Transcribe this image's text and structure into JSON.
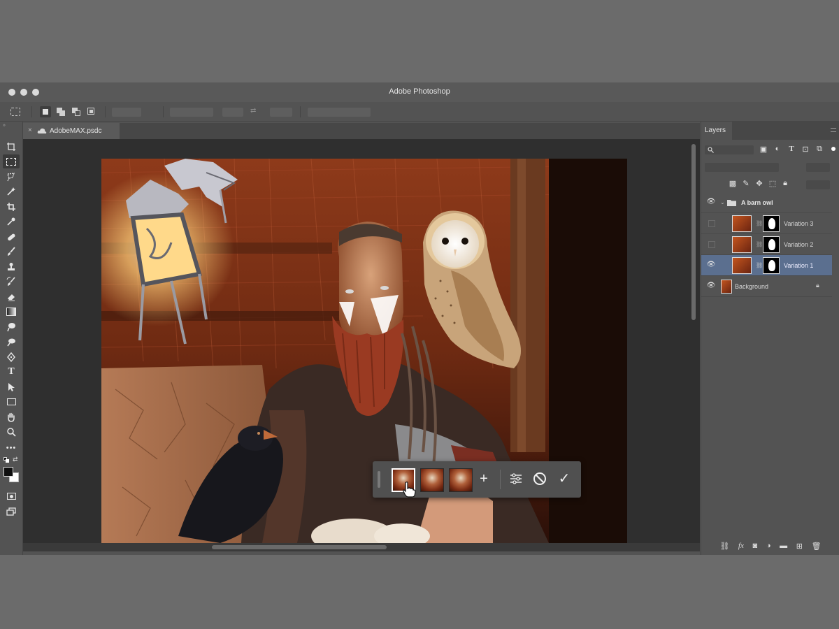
{
  "app": {
    "title": "Adobe Photoshop"
  },
  "document": {
    "tab_name": "AdobeMAX.psdc",
    "close_symbol": "×"
  },
  "toolbar": {
    "tools": [
      "move-tool",
      "marquee-tool",
      "lasso-tool",
      "magic-wand-tool",
      "crop-tool",
      "eyedropper-tool",
      "healing-tool",
      "brush-tool",
      "clone-stamp-tool",
      "history-brush-tool",
      "eraser-tool",
      "gradient-tool",
      "smudge-tool",
      "dodge-tool",
      "pen-tool",
      "type-tool",
      "path-selection-tool",
      "rectangle-tool",
      "hand-tool",
      "zoom-tool",
      "more-tools"
    ],
    "type_glyph": "T"
  },
  "layers_panel": {
    "tab_label": "Layers",
    "layers": [
      {
        "name": "A barn owl",
        "kind": "group",
        "visible": true
      },
      {
        "name": "Variation 3",
        "kind": "layer",
        "visible": false
      },
      {
        "name": "Variation 2",
        "kind": "layer",
        "visible": false
      },
      {
        "name": "Variation 1",
        "kind": "layer",
        "visible": true,
        "selected": true
      },
      {
        "name": "Background",
        "kind": "background",
        "visible": true,
        "locked": true
      }
    ]
  },
  "variations_bar": {
    "thumbnails": 3,
    "selected_index": 0,
    "add_symbol": "+",
    "confirm_symbol": "✓"
  },
  "colors": {
    "app_bg": "#535353",
    "canvas_bg": "#2f2f2f",
    "selection": "#5b6f8f"
  }
}
